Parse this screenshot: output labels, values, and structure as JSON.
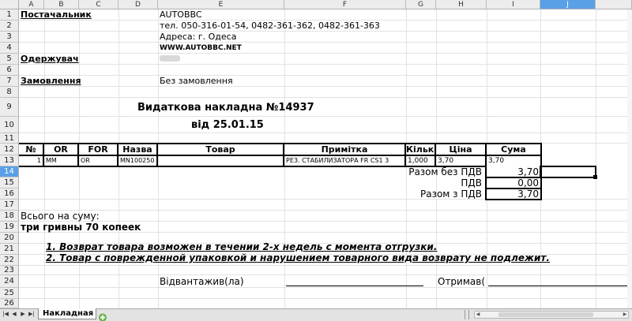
{
  "columns": [
    "A",
    "B",
    "C",
    "D",
    "E",
    "F",
    "G",
    "H",
    "I",
    "J"
  ],
  "rows": [
    "1",
    "2",
    "3",
    "4",
    "5",
    "6",
    "7",
    "8",
    "9",
    "10",
    "11",
    "12",
    "13",
    "14",
    "15",
    "16",
    "17",
    "18",
    "19",
    "20",
    "21",
    "22",
    "23",
    "24",
    "25",
    "26"
  ],
  "supplier": {
    "label": "Постачальник",
    "name": "AUTOBBC",
    "phones": "тел. 050-316-01-54, 0482-361-362, 0482-361-363",
    "address": "Адреса: г. Одеса",
    "site": "WWW.AUTOBBC.NET"
  },
  "recipient": {
    "label": "Одержувач"
  },
  "order": {
    "label": "Замовлення",
    "value": "Без замовлення"
  },
  "doc": {
    "title": "Видаткова накладна №14937",
    "date": "від 25.01.15"
  },
  "table": {
    "headers": [
      "№",
      "OR",
      "FOR",
      "Назва",
      "Товар",
      "Примітка",
      "Кількі",
      "Ціна",
      "Сума"
    ],
    "row": [
      "1",
      "MM",
      "OR",
      "MN100250",
      "",
      "РЕЗ. СТАБИЛИЗАТОРА FR   CS1 3",
      "1,000",
      "3,70",
      "3,70"
    ]
  },
  "totals": [
    {
      "label": "Разом без ПДВ",
      "value": "3,70"
    },
    {
      "label": "ПДВ",
      "value": "0,00"
    },
    {
      "label": "Разом з ПДВ",
      "value": "3,70"
    }
  ],
  "sum_label": "Всього на суму:",
  "sum_words": "три гривны 70 копеек",
  "notes": [
    "1. Возврат товара возможен в течении 2-х недель с момента отгрузки.",
    "2. Товар с поврежденной упаковкой и нарушением товарного вида возврату не подлежит."
  ],
  "signatures": {
    "shipped": "Відвантажив(ла)",
    "received": "Отримав("
  },
  "sheet_tab": "Накладная",
  "colors": {
    "selection": "#5aa0e6",
    "header_bg": "#ececec"
  }
}
